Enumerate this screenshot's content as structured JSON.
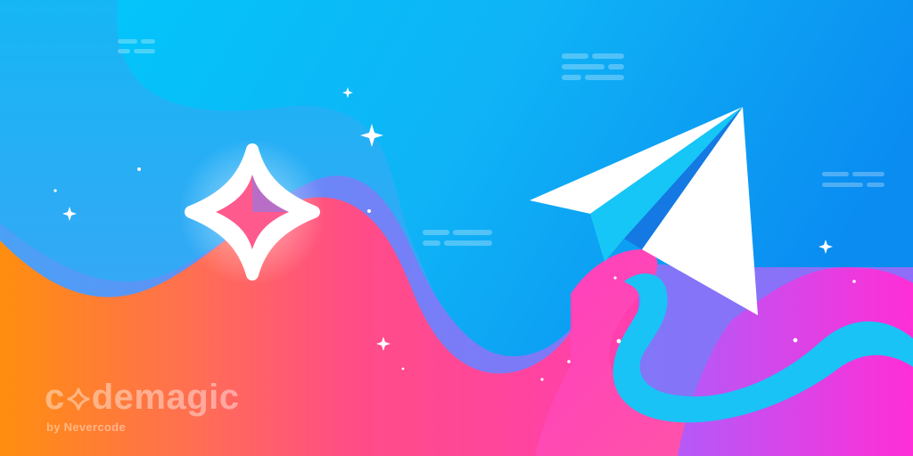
{
  "logo": {
    "word_first": "c",
    "word_rest": "demagic",
    "tagline": "by Nevercode"
  },
  "icons": {
    "brand_mark": "codemagic-star-icon",
    "plane": "paper-plane-icon",
    "sparkle": "sparkle-icon",
    "text_lines": "text-lines-decoration"
  },
  "colors": {
    "sky_top": "#00c8fb",
    "sky_right": "#0a8ef2",
    "orange": "#ff8d10",
    "pink": "#ff4f8f",
    "magenta": "#ff2bd2",
    "violet": "#8a6cf8",
    "plane_white": "#ffffff",
    "plane_cyan": "#14c6f5",
    "plane_blue": "#1980e8"
  }
}
